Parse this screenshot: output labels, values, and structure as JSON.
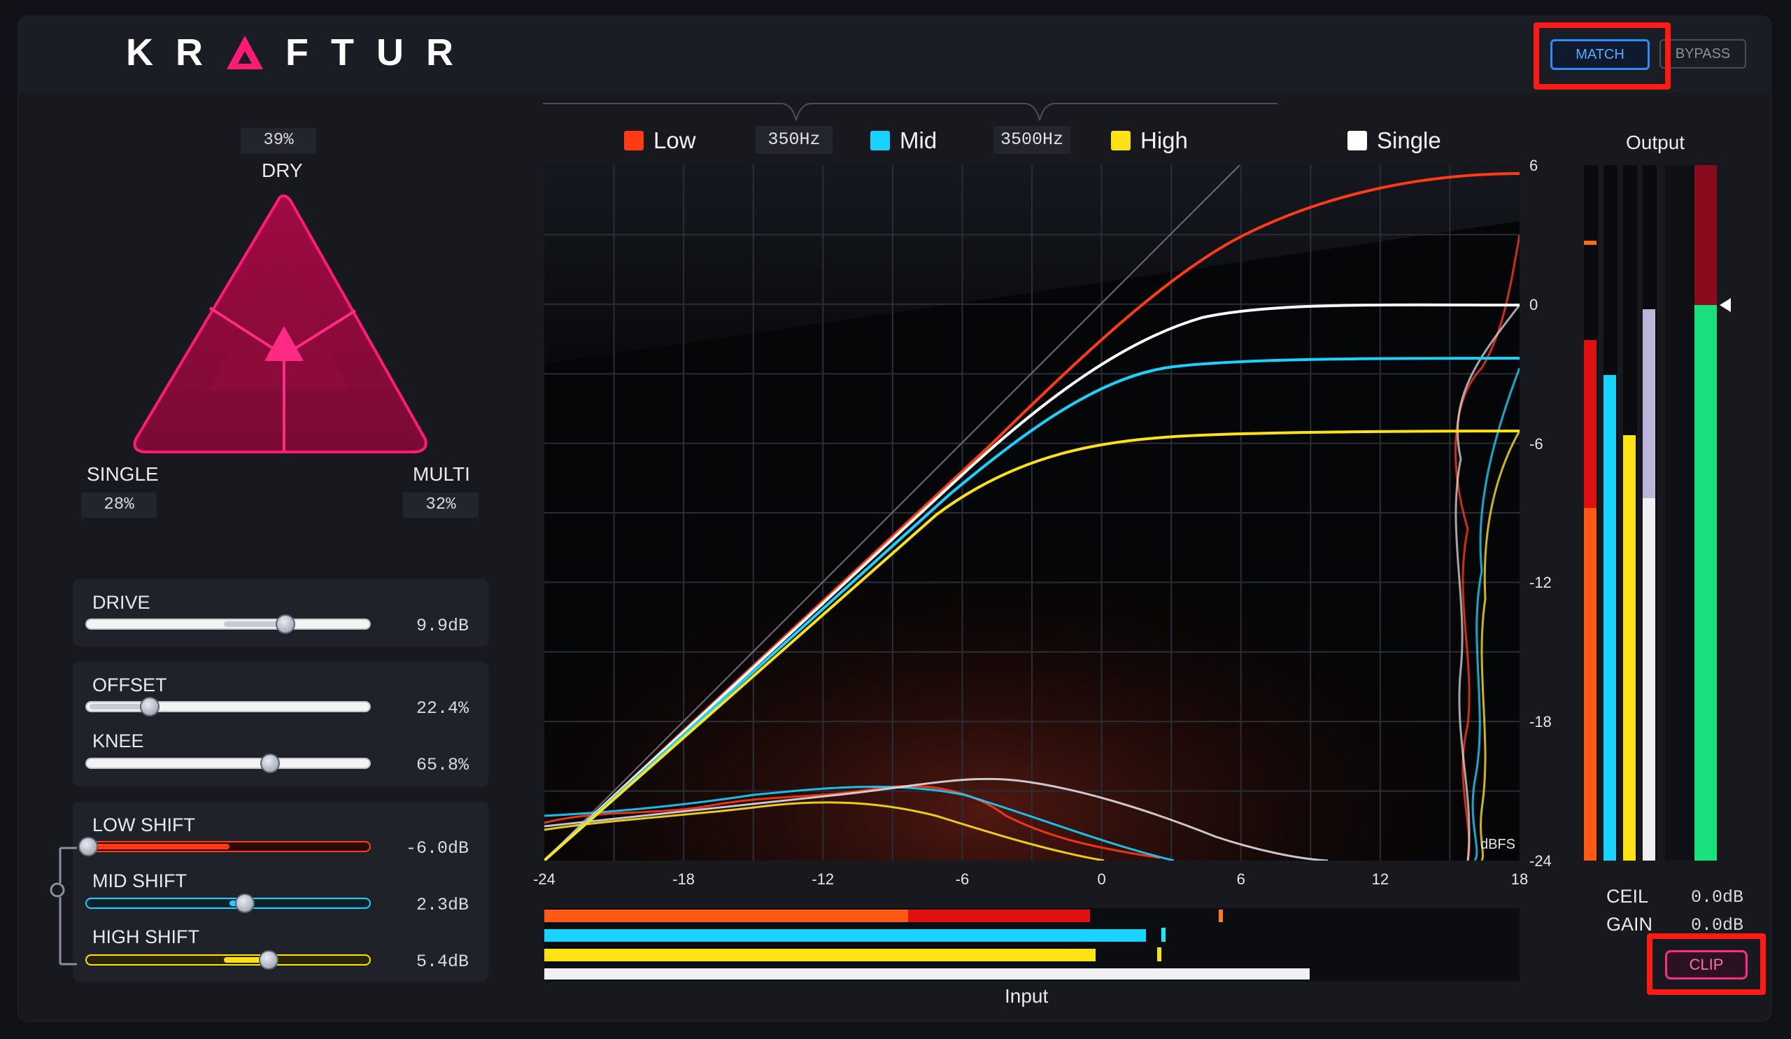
{
  "app": {
    "brand": "KRAFTUR"
  },
  "header": {
    "match_label": "MATCH",
    "bypass_label": "BYPASS"
  },
  "mix": {
    "dry_label": "DRY",
    "dry_value": "39%",
    "single_label": "SINGLE",
    "single_value": "28%",
    "multi_label": "MULTI",
    "multi_value": "32%"
  },
  "controls": {
    "drive": {
      "label": "DRIVE",
      "value": "9.9dB",
      "fraction": 0.7
    },
    "offset": {
      "label": "OFFSET",
      "value": "22.4%",
      "fraction": 0.22
    },
    "knee": {
      "label": "KNEE",
      "value": "65.8%",
      "fraction": 0.66
    },
    "low_shift": {
      "label": "LOW SHIFT",
      "value": "-6.0dB",
      "fraction": 0.0
    },
    "mid_shift": {
      "label": "MID SHIFT",
      "value": "2.3dB",
      "fraction": 0.56
    },
    "high_shift": {
      "label": "HIGH SHIFT",
      "value": "5.4dB",
      "fraction": 0.64
    }
  },
  "graph": {
    "legend": {
      "low": "Low",
      "mid": "Mid",
      "high": "High",
      "single": "Single"
    },
    "crossover_low": "350Hz",
    "crossover_high": "3500Hz",
    "x_ticks": [
      "-24",
      "-18",
      "-12",
      "-6",
      "0",
      "6",
      "12",
      "18"
    ],
    "y_ticks": [
      "6",
      "0",
      "-6",
      "-12",
      "-18",
      "-24"
    ],
    "x_label": "Input",
    "unit_label": "dBFS"
  },
  "output": {
    "title": "Output",
    "ceil_label": "CEIL",
    "ceil_value": "0.0dB",
    "gain_label": "GAIN",
    "gain_value": "0.0dB",
    "clip_label": "CLIP"
  },
  "colors": {
    "accent": "#ff1a78",
    "low": "#ff3a14",
    "mid": "#18d2ff",
    "high": "#ffe213",
    "single": "#ffffff",
    "match": "#2a8cff",
    "meter_green": "#18e07c"
  }
}
